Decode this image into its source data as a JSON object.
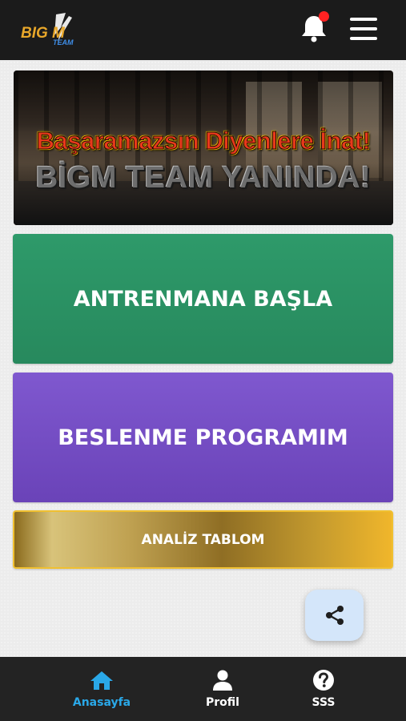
{
  "header": {
    "logo_icon": "bigm-team-logo",
    "logo_text_main": "BIG M",
    "logo_text_sub": "TEAM",
    "notification_icon": "bell-icon",
    "menu_icon": "hamburger-menu-icon",
    "colors": {
      "background": "#1b1b1b",
      "notification_dot": "#ff2222"
    }
  },
  "banner": {
    "line1": "Başaramazsın Diyenlere İnat!",
    "line2": "BİGM TEAM YANINDA!"
  },
  "cards": {
    "workout_label": "ANTRENMANA BAŞLA",
    "nutrition_label": "BESLENME PROGRAMIM",
    "analysis_label": "ANALİZ TABLOM",
    "colors": {
      "workout": "#2e9a6a",
      "nutrition": "#7f58cf",
      "analysis": "#c49a2e"
    }
  },
  "share_button": {
    "icon": "share-icon",
    "color": "#d4e6fa"
  },
  "bottom_nav": {
    "items": [
      {
        "label": "Anasayfa",
        "icon": "home-icon",
        "active": true
      },
      {
        "label": "Profil",
        "icon": "user-icon",
        "active": false
      },
      {
        "label": "SSS",
        "icon": "question-circle-icon",
        "active": false
      }
    ],
    "active_color": "#2aa8e8"
  }
}
